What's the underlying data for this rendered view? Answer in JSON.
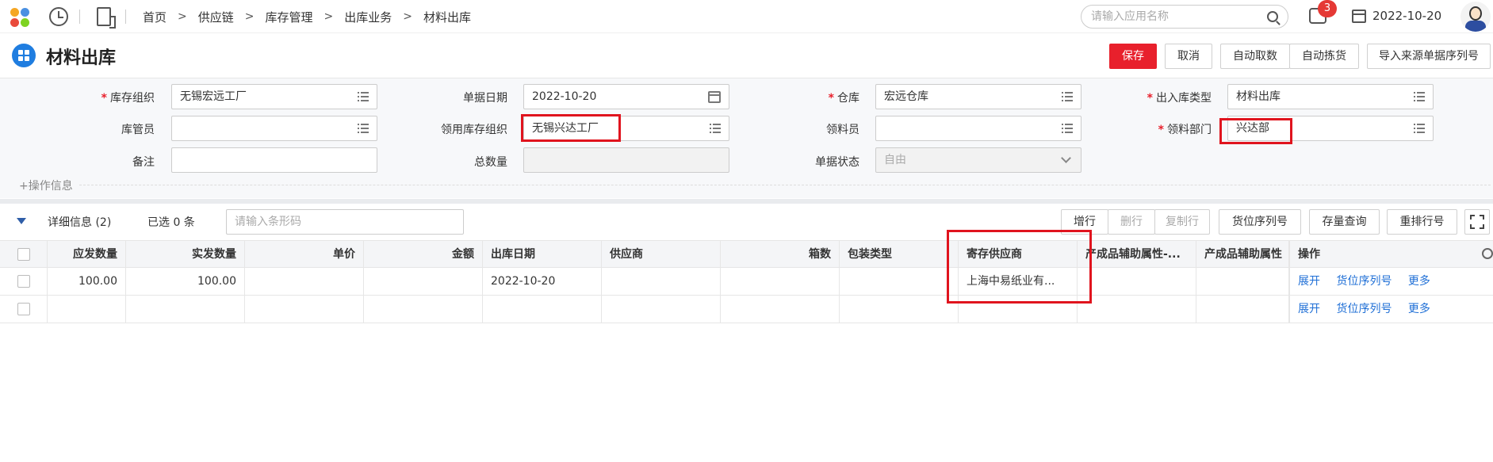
{
  "topbar": {
    "breadcrumb": [
      "首页",
      "供应链",
      "库存管理",
      "出库业务",
      "材料出库"
    ],
    "search_placeholder": "请输入应用名称",
    "notification_count": "3",
    "date": "2022-10-20"
  },
  "header": {
    "title": "材料出库",
    "buttons": {
      "save": "保存",
      "cancel": "取消",
      "auto_fetch": "自动取数",
      "auto_pick": "自动拣货",
      "import_serial": "导入来源单据序列号"
    }
  },
  "form": {
    "stock_org_label": "库存组织",
    "stock_org_value": "无锡宏远工厂",
    "doc_date_label": "单据日期",
    "doc_date_value": "2022-10-20",
    "warehouse_label": "仓库",
    "warehouse_value": "宏远仓库",
    "io_type_label": "出入库类型",
    "io_type_value": "材料出库",
    "keeper_label": "库管员",
    "keeper_value": "",
    "use_org_label": "领用库存组织",
    "use_org_value": "无锡兴达工厂",
    "receiver_label": "领料员",
    "receiver_value": "",
    "dept_label": "领料部门",
    "dept_value": "兴达部",
    "remark_label": "备注",
    "remark_value": "",
    "total_qty_label": "总数量",
    "total_qty_value": "",
    "status_label": "单据状态",
    "status_value": "自由",
    "op_info": "+操作信息"
  },
  "detail": {
    "title": "详细信息 (2)",
    "selected": "已选 0 条",
    "barcode_placeholder": "请输入条形码",
    "buttons": {
      "add_row": "增行",
      "del_row": "删行",
      "copy_row": "复制行",
      "location_serial": "货位序列号",
      "stock_query": "存量查询",
      "reorder": "重排行号"
    }
  },
  "table": {
    "columns": [
      "应发数量",
      "实发数量",
      "单价",
      "金额",
      "出库日期",
      "供应商",
      "箱数",
      "包装类型",
      "寄存供应商",
      "产成品辅助属性-...",
      "产成品辅助属性",
      "操作"
    ],
    "rows": [
      {
        "should_qty": "100.00",
        "actual_qty": "100.00",
        "price": "",
        "amount": "",
        "out_date": "2022-10-20",
        "supplier": "",
        "boxes": "",
        "pack_type": "",
        "consign_supplier": "上海中易纸业有...",
        "attr1": "",
        "attr2": ""
      },
      {
        "should_qty": "",
        "actual_qty": "",
        "price": "",
        "amount": "",
        "out_date": "",
        "supplier": "",
        "boxes": "",
        "pack_type": "",
        "consign_supplier": "",
        "attr1": "",
        "attr2": ""
      }
    ],
    "actions": [
      "展开",
      "货位序列号",
      "更多"
    ]
  },
  "colors": {
    "primary_red": "#e8202c",
    "link_blue": "#1f6fd6",
    "highlight_red": "#e0141e"
  }
}
